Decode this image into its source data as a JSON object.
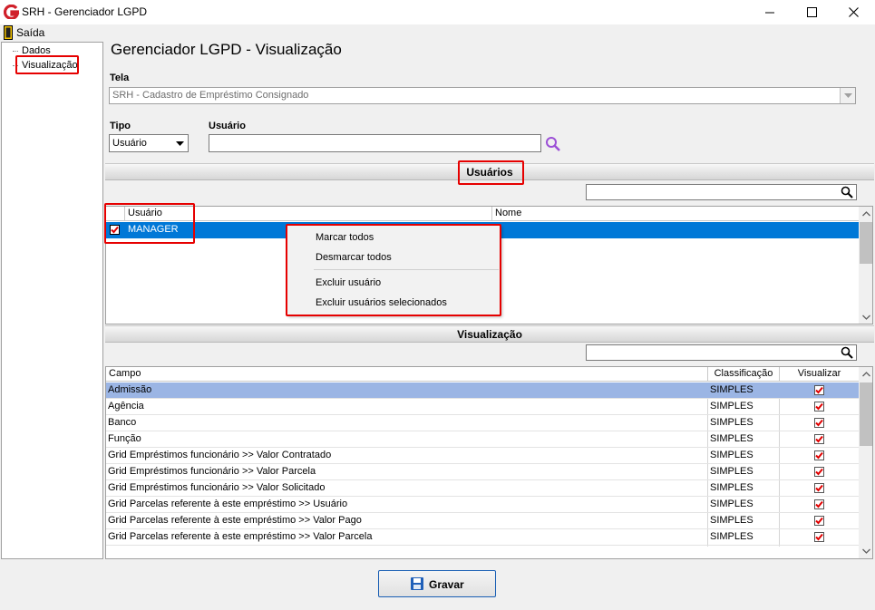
{
  "window": {
    "title": "SRH - Gerenciador LGPD"
  },
  "menu": {
    "exit_label": "Saída"
  },
  "tree": {
    "items": [
      "Dados",
      "Visualização"
    ]
  },
  "page": {
    "title": "Gerenciador LGPD - Visualização"
  },
  "tela": {
    "label": "Tela",
    "value": "SRH - Cadastro de Empréstimo Consignado"
  },
  "tipo": {
    "label": "Tipo",
    "value": "Usuário"
  },
  "usuario_filter": {
    "label": "Usuário",
    "value": ""
  },
  "users_section": {
    "title": "Usuários",
    "columns": [
      "Usuário",
      "Nome"
    ],
    "rows": [
      {
        "checked": true,
        "user": "MANAGER",
        "name": ""
      }
    ]
  },
  "context_menu": {
    "items": [
      "Marcar todos",
      "Desmarcar todos",
      "Excluir usuário",
      "Excluir usuários selecionados"
    ]
  },
  "view_section": {
    "title": "Visualização",
    "columns": [
      "Campo",
      "Classificação",
      "Visualizar"
    ],
    "rows": [
      {
        "campo": "Admissão",
        "classificacao": "SIMPLES",
        "visualizar": true
      },
      {
        "campo": "Agência",
        "classificacao": "SIMPLES",
        "visualizar": true
      },
      {
        "campo": "Banco",
        "classificacao": "SIMPLES",
        "visualizar": true
      },
      {
        "campo": "Função",
        "classificacao": "SIMPLES",
        "visualizar": true
      },
      {
        "campo": "Grid Empréstimos funcionário >> Valor Contratado",
        "classificacao": "SIMPLES",
        "visualizar": true
      },
      {
        "campo": "Grid Empréstimos funcionário >> Valor Parcela",
        "classificacao": "SIMPLES",
        "visualizar": true
      },
      {
        "campo": "Grid Empréstimos funcionário >> Valor Solicitado",
        "classificacao": "SIMPLES",
        "visualizar": true
      },
      {
        "campo": "Grid Parcelas referente à este empréstimo >> Usuário",
        "classificacao": "SIMPLES",
        "visualizar": true
      },
      {
        "campo": "Grid Parcelas referente à este empréstimo >> Valor Pago",
        "classificacao": "SIMPLES",
        "visualizar": true
      },
      {
        "campo": "Grid Parcelas referente à este empréstimo >> Valor Parcela",
        "classificacao": "SIMPLES",
        "visualizar": true
      }
    ]
  },
  "actions": {
    "save_label": "Gravar"
  },
  "colors": {
    "selection": "#0078d7",
    "row_highlight": "#9bb5e4",
    "highlight_border": "#e60000",
    "search_icon": "#9b4fd6"
  }
}
